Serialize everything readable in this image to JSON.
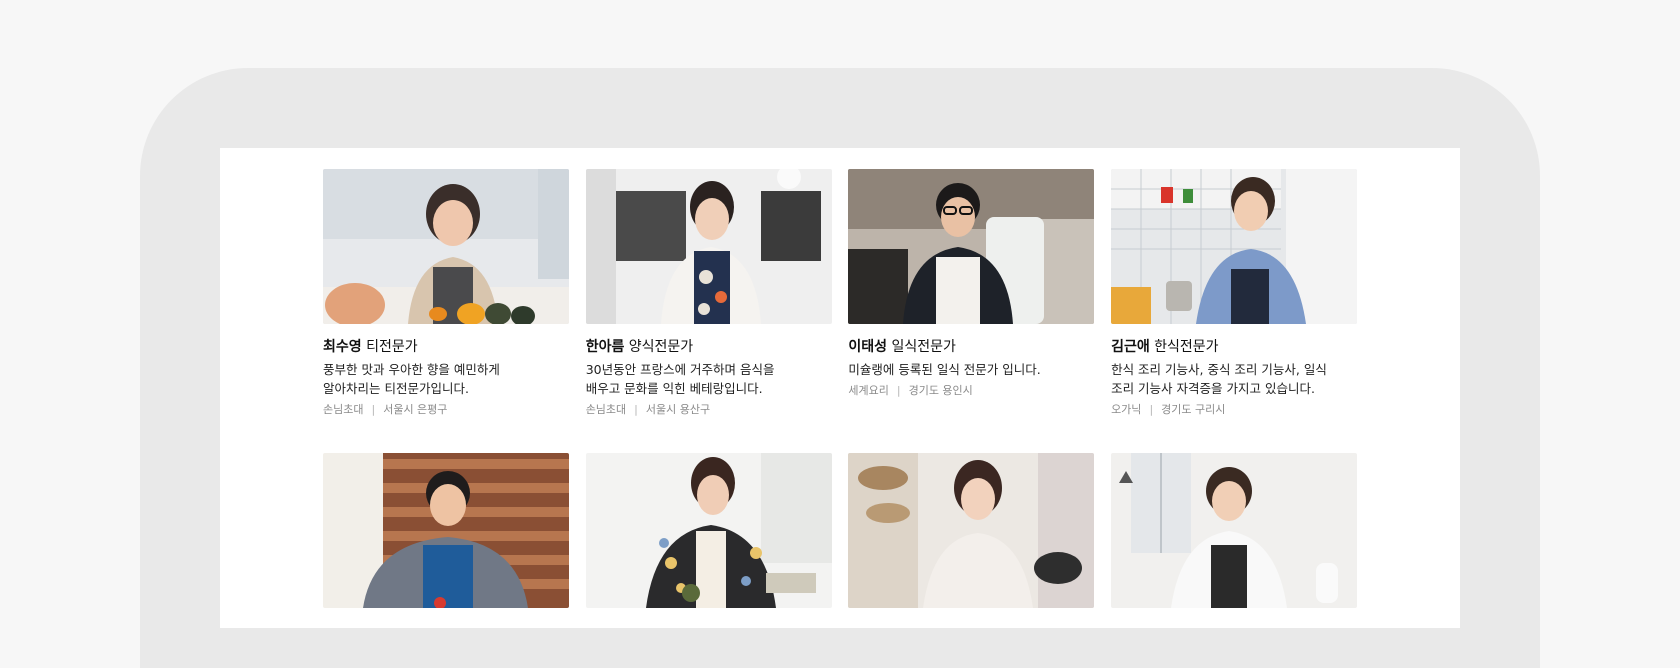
{
  "experts": [
    {
      "name": "최수영",
      "title": "티전문가",
      "description_lines": [
        "풍부한 맛과 우아한  향을 예민하게",
        "알아차리는 티전문가입니다."
      ],
      "category": "손님초대",
      "location": "서울시 은평구",
      "photo_alt": "chef-photo"
    },
    {
      "name": "한아름",
      "title": "양식전문가",
      "description_lines": [
        "30년동안 프랑스에 거주하며 음식을",
        "배우고 문화를 익힌 베테랑입니다."
      ],
      "category": "손님초대",
      "location": "서울시 용산구",
      "photo_alt": "chef-photo"
    },
    {
      "name": "이태성",
      "title": "일식전문가",
      "description_lines": [
        "미슐랭에 등록된 일식 전문가 입니다."
      ],
      "category": "세계요리",
      "location": "경기도 용인시",
      "photo_alt": "chef-photo"
    },
    {
      "name": "김근애",
      "title": "한식전문가",
      "description_lines": [
        "한식 조리 기능사, 중식 조리 기능사, 일식",
        "조리 기능사 자격증을 가지고 있습니다."
      ],
      "category": "오가닉",
      "location": "경기도 구리시",
      "photo_alt": "chef-photo"
    }
  ],
  "colors": {
    "page_background": "#f7f7f7",
    "device_frame": "#e9e9e9",
    "screen": "#ffffff",
    "name_text": "#111111",
    "meta_text": "#8a8a8a"
  }
}
